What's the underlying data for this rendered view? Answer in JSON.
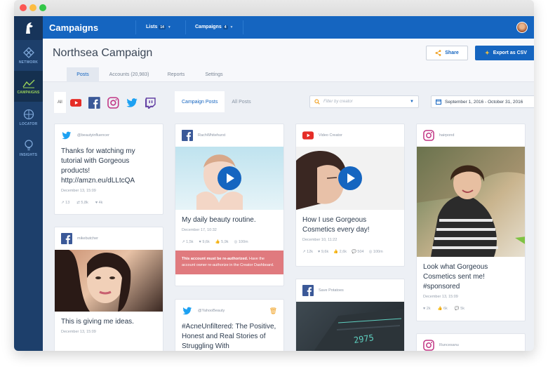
{
  "app": {
    "title": "Campaigns",
    "nav": [
      {
        "label": "NETWORK",
        "icon": "network-icon"
      },
      {
        "label": "CAMPAIGNS",
        "icon": "campaigns-icon"
      },
      {
        "label": "LOCATOR",
        "icon": "locator-icon"
      },
      {
        "label": "INSIGHTS",
        "icon": "insights-icon"
      }
    ],
    "top_tabs": [
      {
        "label": "Lists",
        "count": "14"
      },
      {
        "label": "Campaigns",
        "count": "4"
      }
    ]
  },
  "campaign": {
    "name": "Northsea Campaign",
    "share_label": "Share",
    "export_label": "Export as CSV",
    "tabs": [
      "Posts",
      "Accounts (20,983)",
      "Reports",
      "Settings"
    ]
  },
  "filters": {
    "all_label": "All",
    "networks": [
      "youtube-icon",
      "facebook-icon",
      "instagram-icon",
      "twitter-icon",
      "twitch-icon"
    ],
    "post_tabs": [
      "Campaign Posts",
      "All Posts"
    ],
    "creator_placeholder": "Filter by creator",
    "date_range": "September 1, 2016 - October 31, 2016"
  },
  "posts": [
    {
      "network": "twitter",
      "author": "@beautyinfluencer",
      "text": "Thanks for watching my tutorial with Gorgeous products! http://amzn.eu/dLLtcQA",
      "date": "December 13, 15:09",
      "stats": [
        "13",
        "5,8k",
        "4k"
      ]
    },
    {
      "network": "facebook",
      "author": "mikebutcher",
      "text": "This is giving me ideas.",
      "date": "December 13, 15:09"
    },
    {
      "network": "facebook",
      "author": "RachWhitehurst",
      "text": "My daily beauty routine.",
      "date": "December 17, 10:32",
      "stats": [
        "1,5k",
        "9,6k",
        "5,9k",
        "100m"
      ],
      "alert_bold": "This account must be re-authorized.",
      "alert_rest": "Have the account owner re-authorize in the Creator Dashboard."
    },
    {
      "network": "twitter",
      "author": "@YahooBeauty",
      "text": "#AcneUnfiltered: The Positive, Honest and Real Stories of Struggling With"
    },
    {
      "network": "youtube",
      "author": "Video Creator",
      "text": "How I use Gorgeous Cosmetics every day!",
      "date": "December 10, 11:22",
      "stats": [
        "12k",
        "9,6k",
        "2,6k",
        "504",
        "100m"
      ]
    },
    {
      "network": "facebook",
      "author": "Save Potatoes",
      "image_caption": "2975"
    },
    {
      "network": "instagram",
      "author": "hairpond",
      "text": "Look what Gorgeous Cosmetics sent me! #sponsored",
      "date": "December 13, 15:09",
      "stats": [
        "2k",
        "6k",
        "5k"
      ]
    },
    {
      "network": "instagram",
      "author": "Runcesanu"
    }
  ]
}
